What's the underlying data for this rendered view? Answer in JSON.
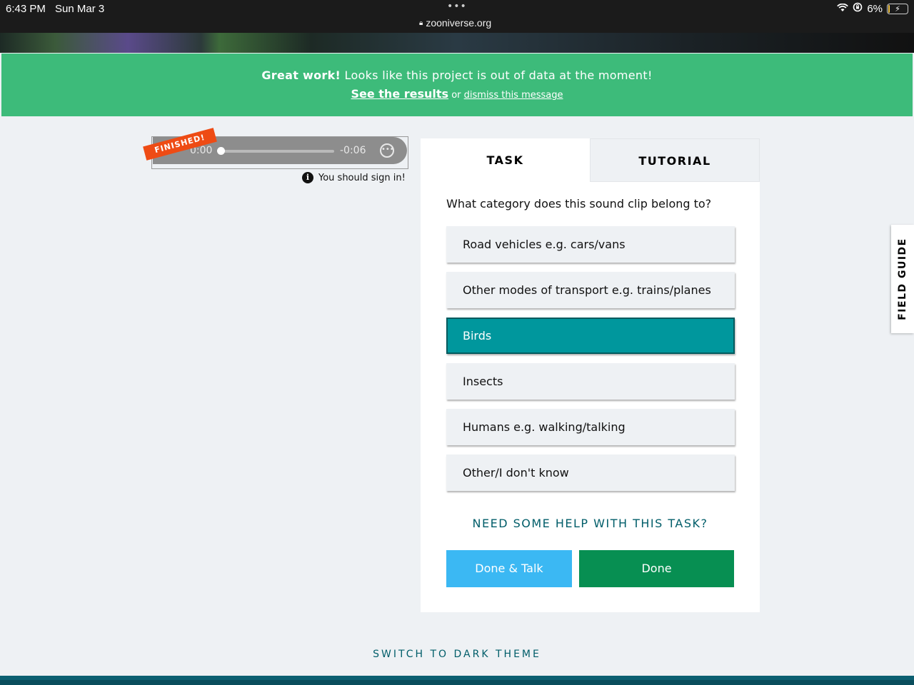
{
  "status_bar": {
    "time": "6:43 PM",
    "date": "Sun Mar 3",
    "dots": "•••",
    "url": "zooniverse.org",
    "battery": "6%",
    "battery_level": 0.06
  },
  "banner": {
    "strong": "Great work!",
    "message": " Looks like this project is out of data at the moment!",
    "results_link": "See the results",
    "or": " or ",
    "dismiss_link": "dismiss this message"
  },
  "player": {
    "ribbon": "FINISHED!",
    "current_time": "0:00",
    "remaining_time": "-0:06"
  },
  "signin": {
    "message": "You should sign in!"
  },
  "tabs": {
    "task": "TASK",
    "tutorial": "TUTORIAL"
  },
  "task": {
    "question": "What category does this sound clip belong to?",
    "answers": [
      {
        "label": "Road vehicles e.g. cars/vans",
        "selected": false
      },
      {
        "label": "Other modes of transport e.g. trains/planes",
        "selected": false
      },
      {
        "label": "Birds",
        "selected": true
      },
      {
        "label": "Insects",
        "selected": false
      },
      {
        "label": "Humans e.g. walking/talking",
        "selected": false
      },
      {
        "label": "Other/I don't know",
        "selected": false
      }
    ],
    "help": "NEED SOME HELP WITH THIS TASK?",
    "done_talk": "Done & Talk",
    "done": "Done"
  },
  "field_guide": "FIELD GUIDE",
  "footer": {
    "dark_theme": "SWITCH TO DARK THEME"
  },
  "colors": {
    "banner": "#3dbb7a",
    "selected_answer": "#00979d",
    "done_talk": "#3bb8f3",
    "done": "#078f52",
    "link_teal": "#005d69",
    "ribbon": "#ee4b14"
  }
}
